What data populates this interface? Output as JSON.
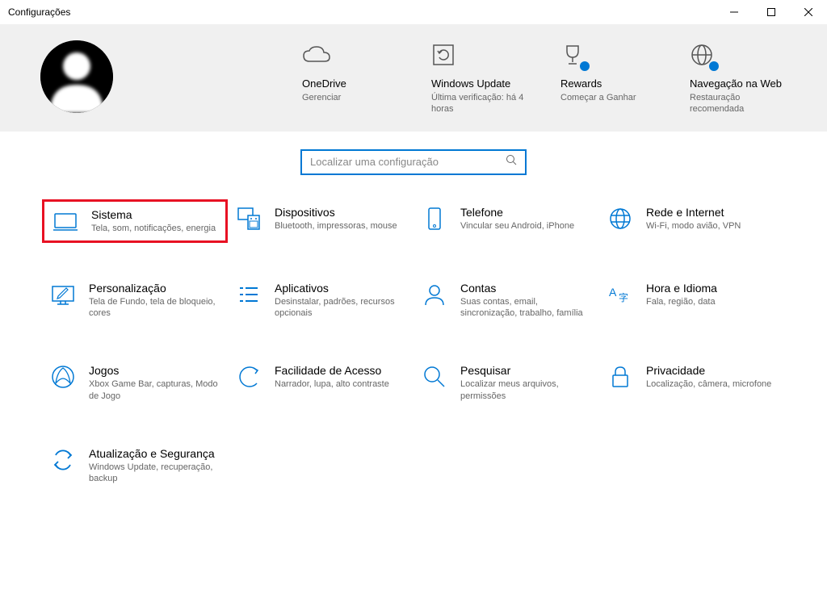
{
  "window": {
    "title": "Configurações"
  },
  "banner": {
    "cards": [
      {
        "title": "OneDrive",
        "sub": "Gerenciar"
      },
      {
        "title": "Windows Update",
        "sub": "Última verificação: há 4 horas"
      },
      {
        "title": "Rewards",
        "sub": "Começar a Ganhar"
      },
      {
        "title": "Navegação na Web",
        "sub": "Restauração recomendada"
      }
    ]
  },
  "search": {
    "placeholder": "Localizar uma configuração"
  },
  "categories": [
    {
      "title": "Sistema",
      "sub": "Tela, som, notificações, energia",
      "highlight": true
    },
    {
      "title": "Dispositivos",
      "sub": "Bluetooth, impressoras, mouse"
    },
    {
      "title": "Telefone",
      "sub": "Vincular seu Android, iPhone"
    },
    {
      "title": "Rede e Internet",
      "sub": "Wi-Fi, modo avião, VPN"
    },
    {
      "title": "Personalização",
      "sub": "Tela de Fundo, tela de bloqueio, cores"
    },
    {
      "title": "Aplicativos",
      "sub": "Desinstalar, padrões, recursos opcionais"
    },
    {
      "title": "Contas",
      "sub": "Suas contas, email, sincronização, trabalho, família"
    },
    {
      "title": "Hora e Idioma",
      "sub": "Fala, região, data"
    },
    {
      "title": "Jogos",
      "sub": "Xbox Game Bar, capturas, Modo de Jogo"
    },
    {
      "title": "Facilidade de Acesso",
      "sub": "Narrador, lupa, alto contraste"
    },
    {
      "title": "Pesquisar",
      "sub": "Localizar meus arquivos, permissões"
    },
    {
      "title": "Privacidade",
      "sub": "Localização, câmera, microfone"
    },
    {
      "title": "Atualização e Segurança",
      "sub": "Windows Update, recuperação, backup"
    }
  ]
}
